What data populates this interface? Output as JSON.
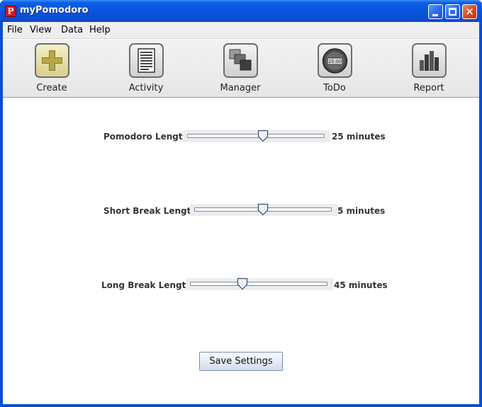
{
  "window": {
    "title": "myPomodoro",
    "app_icon_letter": "P",
    "controls": {
      "minimize": "minimize",
      "maximize": "maximize",
      "close": "×"
    }
  },
  "menu": [
    "File",
    "View",
    "Data",
    "Help"
  ],
  "toolbar": [
    {
      "label": "Create",
      "icon": "plus-icon"
    },
    {
      "label": "Activity",
      "icon": "document-icon"
    },
    {
      "label": "Manager",
      "icon": "stacked-squares-icon"
    },
    {
      "label": "ToDo",
      "icon": "timer-icon",
      "icon_text": "25:00"
    },
    {
      "label": "Report",
      "icon": "bar-chart-icon"
    }
  ],
  "settings": [
    {
      "label": "Pomodoro Length:",
      "value": "25 minutes",
      "fraction": 0.55
    },
    {
      "label": "Short Break Length:",
      "value": "5 minutes",
      "fraction": 0.5
    },
    {
      "label": "Long Break Length:",
      "value": "45 minutes",
      "fraction": 0.38
    }
  ],
  "save_label": "Save Settings",
  "colors": {
    "title_bar": "#0a4fd6",
    "close_button": "#dc4a22",
    "create_icon": "#b7a74a"
  }
}
